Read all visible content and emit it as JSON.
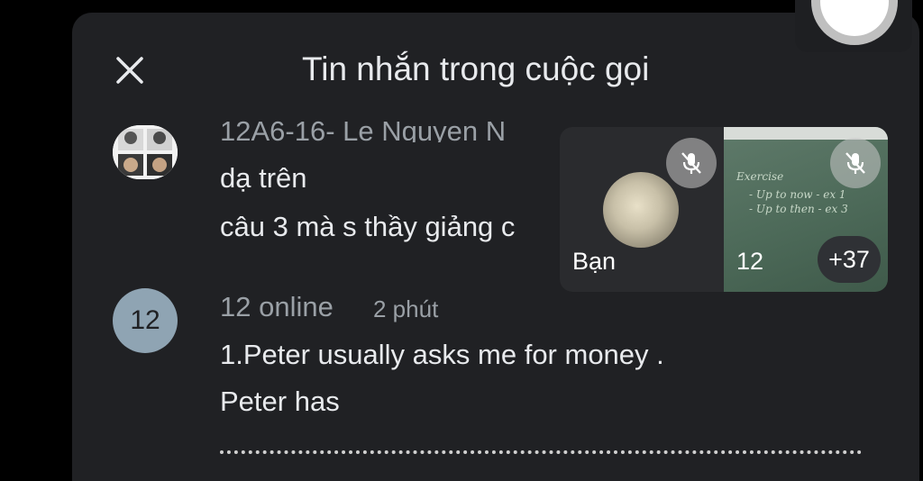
{
  "header": {
    "title": "Tin nhắn trong cuộc gọi",
    "close_icon": "close-icon"
  },
  "messages": [
    {
      "sender": "12A6-16- Le Nguyen N",
      "avatar": "photo",
      "lines": [
        "dạ trên",
        "câu 3 mà s thầy giảng c"
      ]
    },
    {
      "sender": "12 online",
      "time": "2 phút",
      "avatar_text": "12",
      "lines": [
        "1.Peter usually asks me for money .",
        "Peter has"
      ]
    }
  ],
  "video": {
    "self_label": "Bạn",
    "other_label": "12",
    "more_count": "+37",
    "board_lines": [
      "Exercise",
      "- Up to now - ex 1",
      "- Up to then - ex 3"
    ],
    "mic_icon": "mic-off-icon"
  },
  "colors": {
    "panel_bg": "#202124",
    "avatar_blue": "#8fa4b3",
    "muted_text": "#9aa0a6"
  }
}
